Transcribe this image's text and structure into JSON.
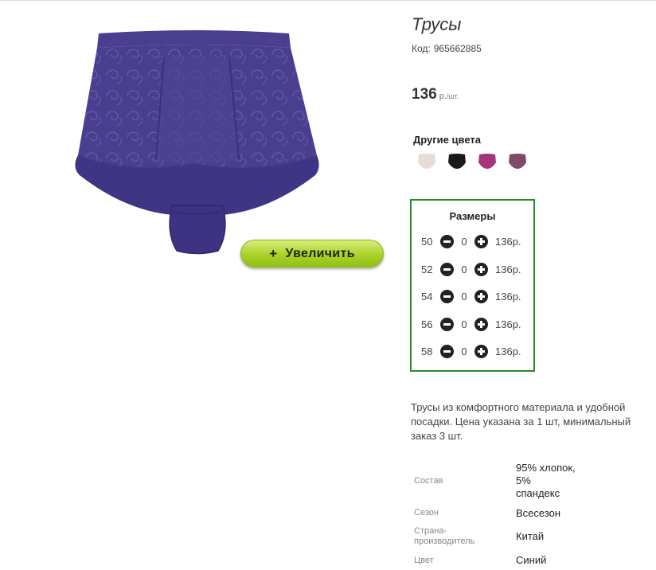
{
  "product": {
    "title": "Трусы",
    "code_label": "Код:",
    "code_value": "965662885",
    "price_value": "136",
    "price_unit": "р.",
    "price_per": "/шт.",
    "zoom_button": {
      "plus": "+",
      "label": "Увеличить"
    },
    "image_colors": {
      "fabric": "#4a3f8e",
      "pattern": "#5c52a3",
      "shadow": "#34296e"
    }
  },
  "other_colors": {
    "title": "Другие цвета",
    "swatches": [
      {
        "name": "beige",
        "color": "#eadbd3"
      },
      {
        "name": "black",
        "color": "#1a1a1a"
      },
      {
        "name": "magenta",
        "color": "#a4357a"
      },
      {
        "name": "mauve",
        "color": "#7d4a6c"
      }
    ]
  },
  "sizes": {
    "title": "Размеры",
    "border_color": "#2a8a2a",
    "rows": [
      {
        "size": "50",
        "qty": "0",
        "price": "136р."
      },
      {
        "size": "52",
        "qty": "0",
        "price": "136р."
      },
      {
        "size": "54",
        "qty": "0",
        "price": "136р."
      },
      {
        "size": "56",
        "qty": "0",
        "price": "136р."
      },
      {
        "size": "58",
        "qty": "0",
        "price": "136р."
      }
    ]
  },
  "description": "Трусы из комфортного материала и удобной посадки. Цена указана за 1 шт, минимальный заказ 3 шт.",
  "specs": {
    "composition_label": "Состав",
    "composition_value": [
      "95% хлопок,",
      "5%",
      "спандекс"
    ],
    "season_label": "Сезон",
    "season_value": "Всесезон",
    "country_label": [
      "Страна-",
      "производитель"
    ],
    "country_value": "Китай",
    "color_label": "Цвет",
    "color_value": "Синий"
  }
}
